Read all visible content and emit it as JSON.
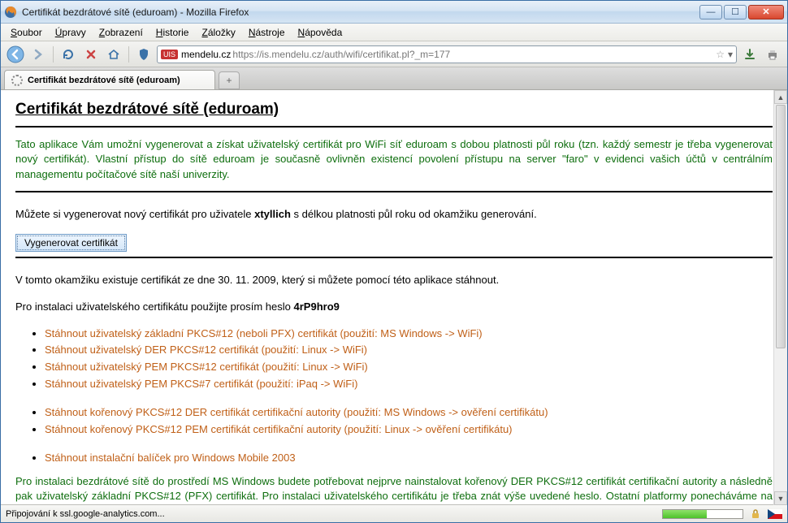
{
  "window": {
    "title": "Certifikát bezdrátové sítě (eduroam) - Mozilla Firefox"
  },
  "menu": {
    "items": [
      {
        "l": "S",
        "rest": "oubor"
      },
      {
        "l": "Ú",
        "rest": "pravy"
      },
      {
        "l": "Z",
        "rest": "obrazení"
      },
      {
        "l": "H",
        "rest": "istorie"
      },
      {
        "l": "Z",
        "rest": "áložky"
      },
      {
        "l": "N",
        "rest": "ástroje"
      },
      {
        "l": "N",
        "rest": "ápověda"
      }
    ]
  },
  "url": {
    "prefix_badge": "UIS",
    "host": "mendelu.cz",
    "path": "https://is.mendelu.cz/auth/wifi/certifikat.pl?_m=177"
  },
  "tab": {
    "title": "Certifikát bezdrátové sítě (eduroam)"
  },
  "page": {
    "title": "Certifikát bezdrátové sítě (eduroam)",
    "intro": "Tato aplikace Vám umožní vygenerovat a získat uživatelský certifikát pro WiFi síť eduroam s dobou platnosti půl roku (tzn. každý semestr je třeba vygenerovat nový certifikát). Vlastní přístup do sítě eduroam je současně ovlivněn existencí povolení přístupu na server \"faro\" v evidenci vašich účtů v centrálním managementu počítačové sítě naší univerzity.",
    "gen1": "Můžete si vygenerovat nový certifikát pro uživatele ",
    "username": "xtyllich",
    "gen2": " s délkou platnosti půl roku od okamžiku generování.",
    "button": "Vygenerovat certifikát",
    "exists": "V tomto okamžiku existuje certifikát ze dne 30. 11. 2009, který si můžete pomocí této aplikace stáhnout.",
    "pwline": "Pro instalaci uživatelského certifikátu použijte prosím heslo ",
    "password": "4rP9hro9",
    "downloads1": [
      "Stáhnout uživatelský základní PKCS#12 (neboli PFX) certifikát (použití: MS Windows -> WiFi)",
      "Stáhnout uživatelský DER PKCS#12 certifikát (použití: Linux -> WiFi)",
      "Stáhnout uživatelský PEM PKCS#12 certifikát (použití: Linux -> WiFi)",
      "Stáhnout uživatelský PEM PKCS#7 certifikát (použití: iPaq -> WiFi)"
    ],
    "downloads2": [
      "Stáhnout kořenový PKCS#12 DER certifikát certifikační autority (použití: MS Windows -> ověření certifikátu)",
      "Stáhnout kořenový PKCS#12 PEM certifikát certifikační autority (použití: Linux -> ověření certifikátu)"
    ],
    "downloads3": [
      "Stáhnout instalační balíček pro Windows Mobile 2003"
    ],
    "install": "Pro instalaci bezdrátové sítě do prostředí MS Windows budete potřebovat nejprve nainstalovat kořenový DER PKCS#12 certifikát certifikační autority a následně pak uživatelský základní PKCS#12 (PFX) certifikát. Pro instalaci uživatelského certifikátu je třeba znát výše uvedené heslo. Ostatní platformy ponecháváme na technické znalosti uživatelů, příp. na diskuzi v UIS. Instalaci kořenového certifikátu stačí provést pouze jednou, při prodloužení platnosti uživatelského"
  },
  "status": {
    "text": "Připojování k ssl.google-analytics.com..."
  }
}
